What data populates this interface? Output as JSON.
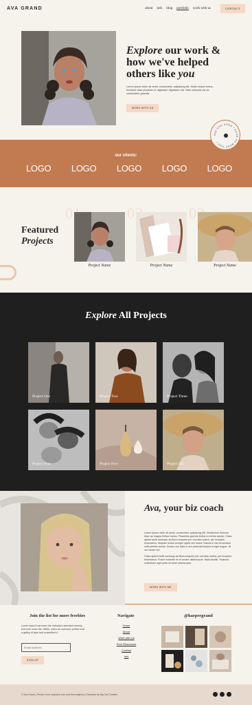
{
  "header": {
    "logo": "AVA GRAND",
    "nav": [
      "about",
      "info",
      "blog",
      "portfolio",
      "work with us"
    ],
    "contact_label": "CONTACT"
  },
  "hero": {
    "heading_em1": "Explore",
    "heading_mid": " our work & how we've helped others like ",
    "heading_em2": "you",
    "body": "Lorem ipsum dolor sit amet, consectetur adipiscing elit. Morbi neque lectus, tincidunt vitae pharetra ut, dignissim dignissim nisl. Nam vehicula est ac consectetur gravida.",
    "button": "WORK WITH US"
  },
  "badge": {
    "text": "SEE YOU SOON • LOVE TO MEET YOU •"
  },
  "clients": {
    "title": "our clients:",
    "logos": [
      "LOGO",
      "LOGO",
      "LOGO",
      "LOGO",
      "LOGO"
    ]
  },
  "featured": {
    "heading_line1": "Featured",
    "heading_line2": "Projects",
    "numbers": [
      "01",
      "02",
      "03"
    ],
    "captions": [
      {
        "a": "Project ",
        "b": "Name"
      },
      {
        "a": "Project ",
        "b": "Name"
      },
      {
        "a": "Project ",
        "b": "Name"
      }
    ]
  },
  "explore": {
    "heading_em": "Explore",
    "heading_rest": " All Projects",
    "tiles": [
      "Project One",
      "Project Two",
      "Project Three",
      "Project Four",
      "Project Five",
      "Project Six"
    ]
  },
  "coach": {
    "heading_em": "Ava,",
    "heading_rest": " your biz coach",
    "body1": "Lorem ipsum dolor sit amet, consectetur adipiscing elit. Vestibulum rhoncus diam ac magna finibus luctus. Phasellus gravida lectus eu lectus auctor. Class aptent taciti sociosqu ad litora torquent per conubia nostra, per inceptos himenaeos. Aliquam lectus semper ligula nec luctus. Mauris in est fermentum velit pretium auctor. Donec non diam a orci placerat tempus id eget augue. Ut vel ornare dui.",
    "body2": "Class aptent taciti sociosqu ad litora torquent per conubia nostra, per inceptos himenaeos. Fusce molestie mi et ornare ullamcorper. Nulla facilisi. Vivamus sollicitudin eget justo sit amet ullamcorper.",
    "button": "WORK WITH ME"
  },
  "footer": {
    "list_title": "Join the list for more freebies",
    "list_body": "Lorem Ipsum has been the industry's standard dummy text ever since the 1500s, when an unknown printer took a galley of type and scrambled it.",
    "email_placeholder": "Email Address",
    "signup": "SIGN UP",
    "nav_title": "Navigate",
    "links": [
      "Home",
      "About",
      "Work with Us",
      "Free Resources",
      "Contact",
      "Info"
    ],
    "insta_title": "@harpergrand"
  },
  "bottom": {
    "text": "© Ava Grand  |  Photos from unsplash.com and thecongency  |  Template by Big Cat Creative"
  },
  "colors": {
    "accent": "#c27a50",
    "peach": "#f5d9c6",
    "cream": "#f6f2ec",
    "dark": "#1f1f1f"
  }
}
